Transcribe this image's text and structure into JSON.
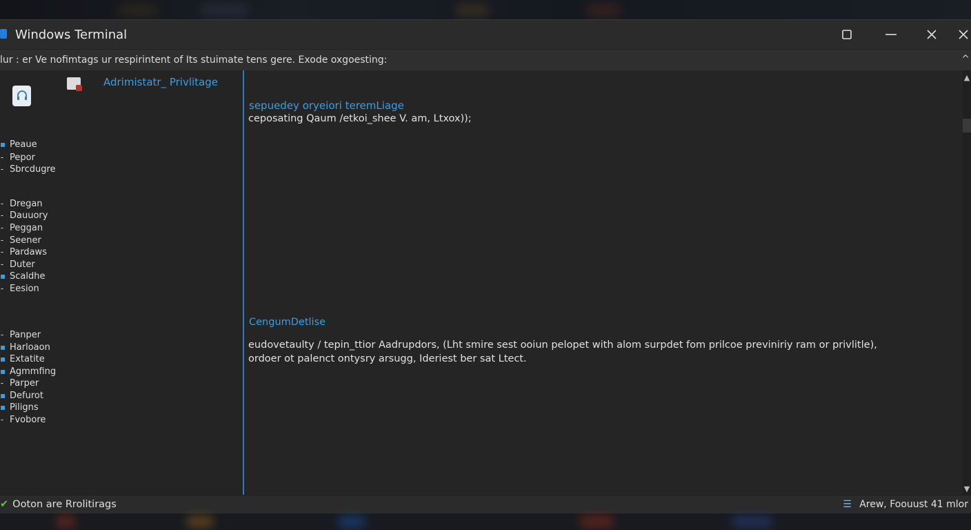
{
  "window": {
    "title": "Windows Terminal",
    "controls": {
      "maximize": "☐",
      "minimize": "—",
      "close": "✕",
      "close2": "✕"
    }
  },
  "infobar": {
    "text": "lur : er  Ve nofimtags ur respirintent of Its stuimate tens gere. Exode oxgoesting:",
    "collapse_glyph": "^"
  },
  "sidebar": {
    "header": "Adrimistatr_ Privlitage",
    "items": [
      {
        "label": "Peaue",
        "bullet": "blue"
      },
      {
        "label": "Pepor",
        "bullet": "dash"
      },
      {
        "label": "Sbrcdugre",
        "bullet": "dash"
      },
      {
        "label": "Dregan",
        "bullet": "dash"
      },
      {
        "label": "Dauuory",
        "bullet": "dash"
      },
      {
        "label": "Peggan",
        "bullet": "dash"
      },
      {
        "label": "Seener",
        "bullet": "dash"
      },
      {
        "label": "Pardaws",
        "bullet": "dash"
      },
      {
        "label": "Duter",
        "bullet": "dash"
      },
      {
        "label": "Scaldhe",
        "bullet": "blue"
      },
      {
        "label": "Eesion",
        "bullet": "dash"
      },
      {
        "label": "Panper",
        "bullet": "dash"
      },
      {
        "label": "Harloaon",
        "bullet": "blue"
      },
      {
        "label": "Extatite",
        "bullet": "blue"
      },
      {
        "label": "Agmmfing",
        "bullet": "blue"
      },
      {
        "label": "Parper",
        "bullet": "dash"
      },
      {
        "label": "Defurot",
        "bullet": "blue"
      },
      {
        "label": "Piligns",
        "bullet": "blue"
      },
      {
        "label": "Fvobore",
        "bullet": "dash"
      }
    ]
  },
  "main": {
    "section1_heading": "sepuedey oryeiori teremLiage",
    "section1_line": "ceposating Qaum /etkoi_shee V. am,  Ltxox));",
    "section2_heading": "CengumDetlise",
    "section2_line1": "eudovetaulty / tepin_ttior Aadrupdors, (Lht smire sest ooiun pelopet with alom surpdet fom prilcoe previniriy ram or privlitle),",
    "section2_line2": "ordoer ot palenct ontysry arsugg,  Ideriest ber sat Ltect."
  },
  "status": {
    "left": "Ooton are Rrolitirags",
    "right": "Arew, Foouust 41 mlor"
  }
}
